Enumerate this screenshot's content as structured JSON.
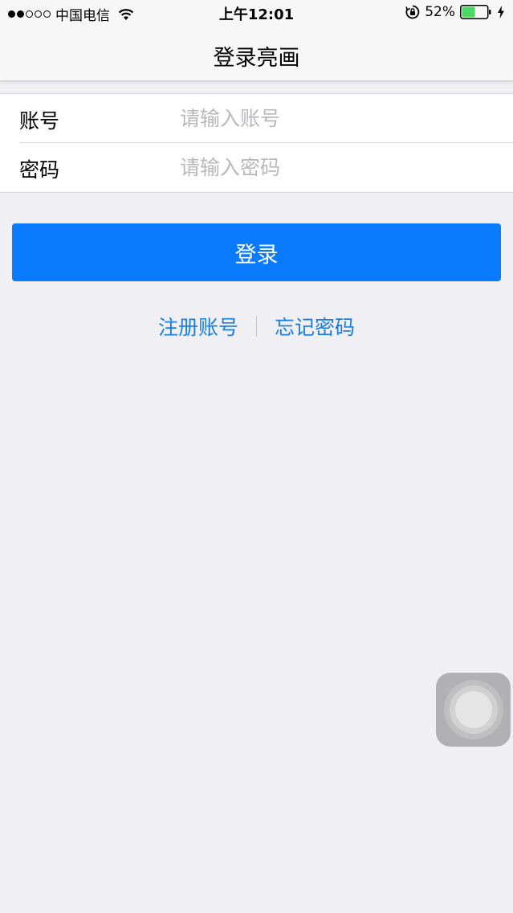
{
  "status_bar": {
    "carrier": "中国电信",
    "time": "上午12:01",
    "battery": "52%",
    "signal_icon": "signal-dots-icon",
    "wifi_icon": "wifi-icon",
    "rotation_lock_icon": "rotation-lock-icon",
    "battery_icon": "battery-icon",
    "charging_icon": "charging-bolt-icon",
    "signal_bars_filled": 2,
    "signal_bars_total": 5,
    "battery_level": 0.52,
    "battery_color": "#4cd964"
  },
  "nav": {
    "title": "登录亮画"
  },
  "form": {
    "account_label": "账号",
    "account_placeholder": "请输入账号",
    "account_value": "",
    "password_label": "密码",
    "password_placeholder": "请输入密码",
    "password_value": ""
  },
  "login_button": {
    "label": "登录",
    "color": "#0a7bff"
  },
  "links": {
    "register": "注册账号",
    "forgot_password": "忘记密码",
    "color": "#1a7ee0"
  },
  "assistive_touch": {
    "icon": "assistive-touch-icon"
  }
}
